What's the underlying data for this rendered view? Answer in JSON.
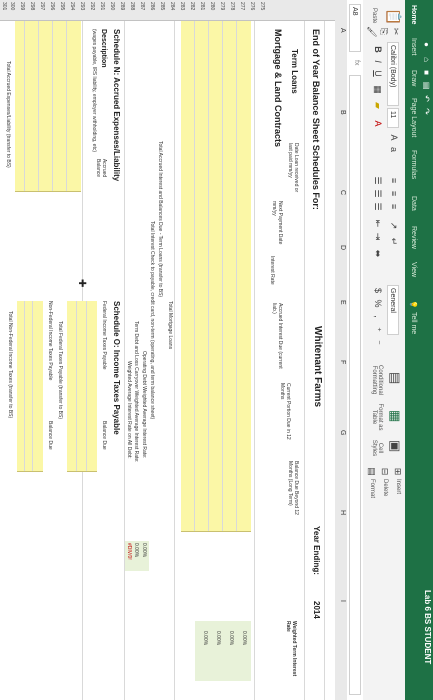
{
  "titlebar": {
    "window_title": "Lab 6 BS STUDENT",
    "tell_me": "Tell me"
  },
  "tabs": [
    "Home",
    "Insert",
    "Draw",
    "Page Layout",
    "Formulas",
    "Data",
    "Review",
    "View"
  ],
  "ribbon": {
    "paste": "Paste",
    "font_name": "Calibri (Body)",
    "font_size": "11",
    "number_format": "General",
    "conditional_formatting": "Conditional Formatting",
    "format_as_table": "Format as Table",
    "cell_styles": "Cell Styles",
    "insert": "Insert",
    "delete": "Delete",
    "format": "Format"
  },
  "formula_bar": {
    "name_box": "A8"
  },
  "columns": [
    "A",
    "B",
    "C",
    "D",
    "E",
    "F",
    "G",
    "H",
    "I"
  ],
  "rows": [
    "275",
    "276",
    "277",
    "278",
    "279",
    "280",
    "281",
    "282",
    "283",
    "284",
    "285",
    "286",
    "287",
    "288",
    "289",
    "290",
    "291",
    "292",
    "293",
    "294",
    "295",
    "296",
    "297",
    "298",
    "299",
    "300",
    "301"
  ],
  "sheet": {
    "title": "End of Year Balance Sheet Schedules For:",
    "farm_name": "Whitenant Farms",
    "year_label": "Year Ending:",
    "year": "2014",
    "term_loans": "Term Loans",
    "mortgage": "Mortgage & Land Contracts",
    "col_date": "Date Loan received or last paid mm/yy",
    "col_next_payment": "Next Payment Date mm/yy",
    "col_interest_rate": "Interest Rate",
    "col_accrued_interest": "Accrued Interest Due (current liab.)",
    "col_current_portion": "Current Portion Due in 12 Months",
    "col_balance_due": "Balance Due Beyond 12 Months (Long Term)",
    "weighted_label": "Weighted Term Interest Rate",
    "weighted_values": [
      "0.00%",
      "0.00%",
      "0.00%",
      "0.00%"
    ],
    "total_mortgage": "Total Mortgage Loans",
    "total_accrued": "Total Accrued Interest and Balances Due - Term Loans (transfer to BS)",
    "total_interest_check": "Total Interest Check to payable, credit card, non-term (operating, and term balance sheet)",
    "operating_debt": "Operating Debt Weighted Average Interest Rate:",
    "term_debt": "Term Debt and Loss Carryover Weighted Average Interest Rate:",
    "weighted_all": "Weighted Average Interest Rate on All Debt:",
    "rate_values": [
      "0.00%",
      "0.00%",
      "#DIV/0!"
    ],
    "schedule_n": "Schedule N: Accrued Expenses/Liability",
    "description": "Description",
    "description_sub": "(wages payable, IRS liability, employer withholding, etc)",
    "accrued_balance": "Accrued Balance",
    "total_accrued_expenses": "Total Accrued Expenses/Liability (transfer to BS)",
    "schedule_o": "Schedule O: Income Taxes Payable",
    "federal_income": "Federal Income Taxes Payable",
    "balance_due": "Balance Due",
    "total_federal": "Total Federal Taxes Payable (transfer to BS)",
    "non_federal": "Non-Federal Income Taxes Payable",
    "balance_due2": "Balance Due",
    "total_non_federal": "Total Non-Federal Income Taxes (transfer to BS)"
  }
}
